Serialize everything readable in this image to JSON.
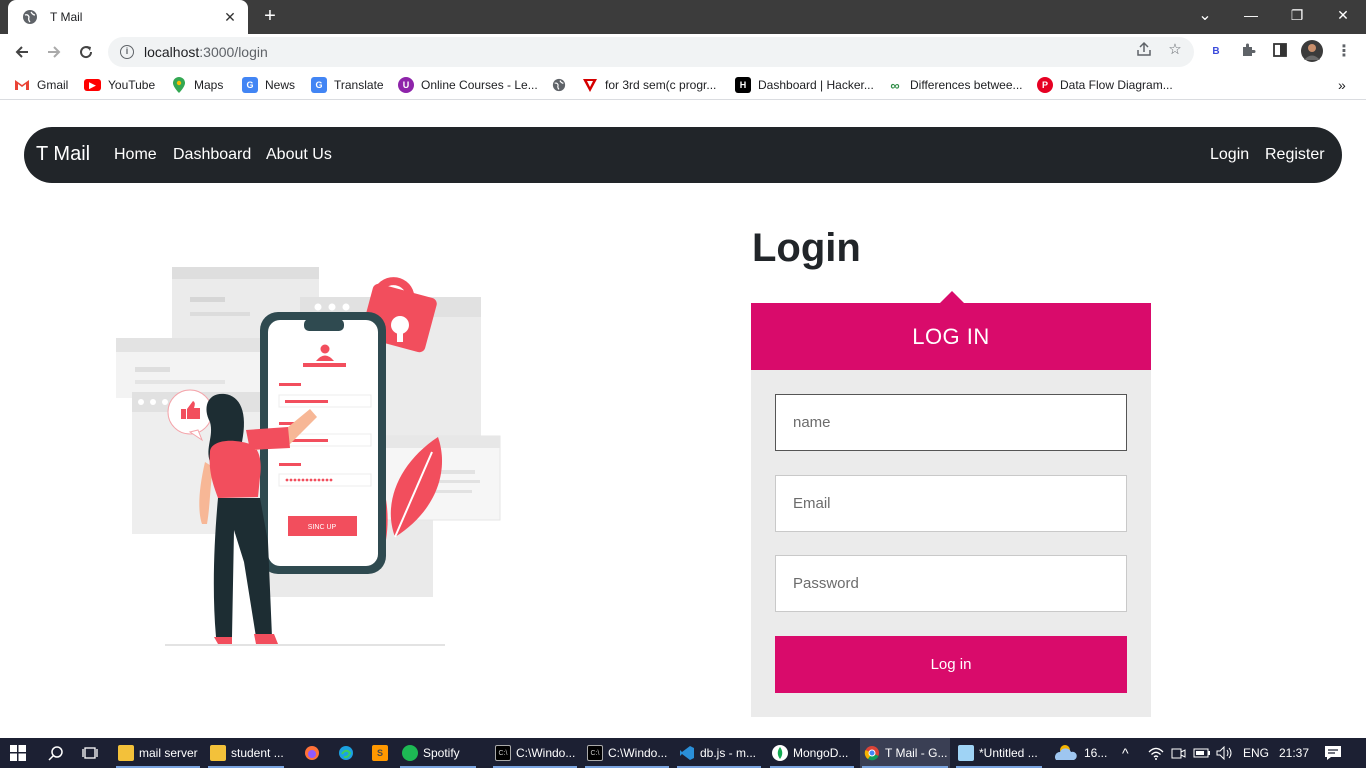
{
  "browser": {
    "tab_title": "T Mail",
    "tab_close": "✕",
    "new_tab": "+",
    "url_host": "localhost",
    "url_path": ":3000/login",
    "window_controls": {
      "minimize": "—",
      "restore": "❐",
      "close": "✕"
    },
    "caret_down": "⌄"
  },
  "bookmarks": [
    {
      "label": "Gmail",
      "icon": "gmail-icon",
      "color": "#ea4335",
      "glyph": "M"
    },
    {
      "label": "YouTube",
      "icon": "youtube-icon",
      "color": "#ff0000",
      "glyph": "▶"
    },
    {
      "label": "Maps",
      "icon": "maps-icon",
      "color": "#34a853",
      "glyph": "◆"
    },
    {
      "label": "News",
      "icon": "news-icon",
      "color": "#4285f4",
      "glyph": "G"
    },
    {
      "label": "Translate",
      "icon": "translate-icon",
      "color": "#4285f4",
      "glyph": "G"
    },
    {
      "label": "Online Courses - Le...",
      "icon": "courses-icon",
      "color": "#8e24aa",
      "glyph": "U"
    },
    {
      "label": "",
      "icon": "globe-icon",
      "color": "#5f6368",
      "glyph": "◍"
    },
    {
      "label": "for 3rd sem(c progr...",
      "icon": "bookmark-v-icon",
      "color": "#d50000",
      "glyph": "V"
    },
    {
      "label": "Dashboard | Hacker...",
      "icon": "hackerrank-icon",
      "color": "#000000",
      "glyph": "H"
    },
    {
      "label": "Differences betwee...",
      "icon": "gfg-icon",
      "color": "#2f8d46",
      "glyph": "∞"
    },
    {
      "label": "Data Flow Diagram...",
      "icon": "pinterest-icon",
      "color": "#e60023",
      "glyph": "P"
    }
  ],
  "bookmarks_overflow": "»",
  "site": {
    "brand": "T Mail",
    "nav_left": [
      "Home",
      "Dashboard",
      "About Us"
    ],
    "nav_right": [
      "Login",
      "Register"
    ]
  },
  "login": {
    "page_title": "Login",
    "card_header": "LOG IN",
    "name_placeholder": "name",
    "email_placeholder": "Email",
    "password_placeholder": "Password",
    "submit_label": "Log in"
  },
  "illustration": {
    "button_text": "SINC UP"
  },
  "colors": {
    "accent": "#d90b6b",
    "navbar": "#212529",
    "illustration_red": "#f24e5d"
  },
  "taskbar": {
    "items": [
      {
        "label": "mail server",
        "icon": "folder-icon"
      },
      {
        "label": "student ...",
        "icon": "folder-icon"
      },
      {
        "label": "",
        "icon": "firefox-icon"
      },
      {
        "label": "",
        "icon": "edge-icon"
      },
      {
        "label": "",
        "icon": "sublime-icon"
      },
      {
        "label": "Spotify",
        "icon": "spotify-icon"
      },
      {
        "label": "C:\\Windo...",
        "icon": "cmd-icon"
      },
      {
        "label": "C:\\Windo...",
        "icon": "cmd-icon"
      },
      {
        "label": "db.js - m...",
        "icon": "vscode-icon"
      },
      {
        "label": "MongoD...",
        "icon": "mongodb-icon"
      },
      {
        "label": "T Mail - G...",
        "icon": "chrome-icon"
      },
      {
        "label": "*Untitled ...",
        "icon": "notepad-icon"
      }
    ],
    "weather": "16...",
    "language": "ENG",
    "time": "21:37"
  }
}
